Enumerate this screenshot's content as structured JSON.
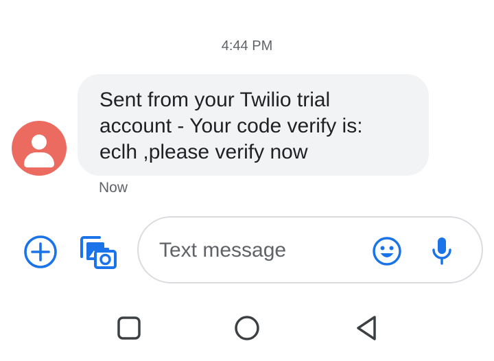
{
  "conversation": {
    "timestamp": "4:44 PM",
    "messages": [
      {
        "direction": "incoming",
        "lines": [
          "Sent from your Twilio trial",
          "account - Your code verify is:",
          "eclh ,please verify now"
        ],
        "status": "Now",
        "avatar_color": "#ec6b60"
      }
    ]
  },
  "compose": {
    "placeholder": "Text message",
    "value": "",
    "accent_color": "#1a73e8"
  },
  "icons": {
    "add": "add-circle-icon",
    "media": "gallery-camera-icon",
    "emoji": "emoji-icon",
    "voice": "microphone-icon",
    "nav_recents": "square-icon",
    "nav_home": "circle-icon",
    "nav_back": "triangle-back-icon"
  }
}
